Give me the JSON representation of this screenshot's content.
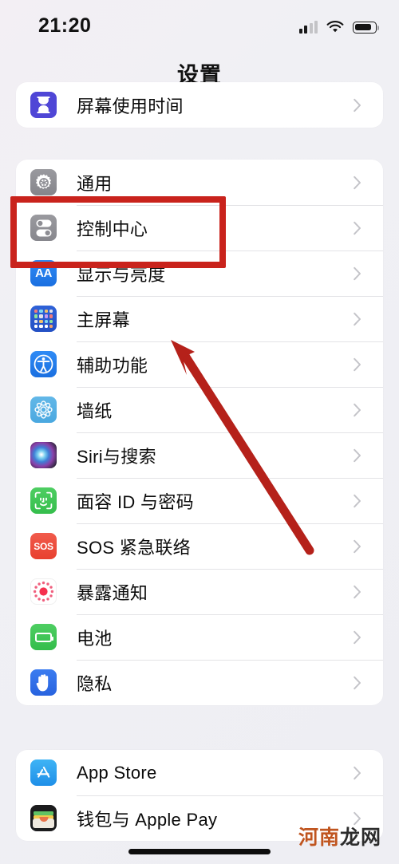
{
  "status_bar": {
    "time": "21:20",
    "signal_icon": "cellular-signal-icon",
    "signal_bars_filled": 2,
    "signal_bars_total": 4,
    "wifi_icon": "wifi-icon",
    "battery_icon": "battery-icon",
    "battery_level_percent": 75
  },
  "nav": {
    "title": "设置"
  },
  "sections": [
    {
      "id": "top",
      "rows": [
        {
          "label": "屏幕使用时间",
          "icon": "screen-time-icon",
          "chevron": "chevron-right-icon"
        }
      ]
    },
    {
      "id": "main",
      "rows": [
        {
          "label": "通用",
          "icon": "general-gear-icon",
          "chevron": "chevron-right-icon"
        },
        {
          "label": "控制中心",
          "icon": "control-center-icon",
          "chevron": "chevron-right-icon"
        },
        {
          "label": "显示与亮度",
          "icon": "display-brightness-icon",
          "chevron": "chevron-right-icon"
        },
        {
          "label": "主屏幕",
          "icon": "home-screen-icon",
          "chevron": "chevron-right-icon"
        },
        {
          "label": "辅助功能",
          "icon": "accessibility-icon",
          "chevron": "chevron-right-icon"
        },
        {
          "label": "墙纸",
          "icon": "wallpaper-icon",
          "chevron": "chevron-right-icon"
        },
        {
          "label": "Siri与搜索",
          "icon": "siri-icon",
          "chevron": "chevron-right-icon"
        },
        {
          "label": "面容 ID 与密码",
          "icon": "face-id-icon",
          "chevron": "chevron-right-icon"
        },
        {
          "label": "SOS 紧急联络",
          "icon": "emergency-sos-icon",
          "chevron": "chevron-right-icon"
        },
        {
          "label": "暴露通知",
          "icon": "exposure-notification-icon",
          "chevron": "chevron-right-icon"
        },
        {
          "label": "电池",
          "icon": "battery-settings-icon",
          "chevron": "chevron-right-icon"
        },
        {
          "label": "隐私",
          "icon": "privacy-hand-icon",
          "chevron": "chevron-right-icon"
        }
      ]
    },
    {
      "id": "store",
      "rows": [
        {
          "label": "App Store",
          "icon": "app-store-icon",
          "chevron": "chevron-right-icon"
        },
        {
          "label": "钱包与 Apple Pay",
          "icon": "wallet-icon",
          "chevron": "chevron-right-icon"
        }
      ]
    }
  ],
  "annotations": {
    "highlight_target": "控制中心",
    "highlight_color": "#c9231c",
    "arrow_color": "#b5211a",
    "arrow_points_to": "控制中心"
  },
  "icon_labels": {
    "display_brightness_text": "AA",
    "sos_text": "SOS"
  },
  "watermark": {
    "text_orange": "河南",
    "text_dark": "龙网",
    "color_orange": "#c0551f",
    "color_dark": "#2c2c2c"
  }
}
